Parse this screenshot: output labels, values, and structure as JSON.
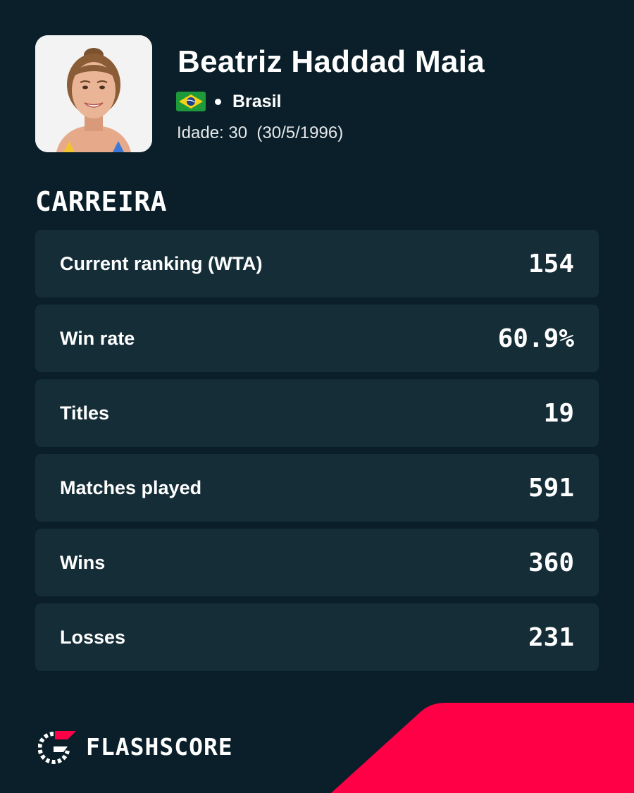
{
  "player": {
    "name": "Beatriz Haddad Maia",
    "country": "Brasil",
    "flag_icon": "brazil-flag-icon",
    "age_line": "Idade: 30  (30/5/1996)"
  },
  "section": {
    "title": "CARREIRA"
  },
  "stats": [
    {
      "label": "Current ranking (WTA)",
      "value": "154"
    },
    {
      "label": "Win rate",
      "value": "60.9%"
    },
    {
      "label": "Titles",
      "value": "19"
    },
    {
      "label": "Matches played",
      "value": "591"
    },
    {
      "label": "Wins",
      "value": "360"
    },
    {
      "label": "Losses",
      "value": "231"
    }
  ],
  "brand": {
    "name": "FLASHSCORE",
    "icon": "flashscore-logo-icon"
  },
  "colors": {
    "background": "#0a1f29",
    "row": "#142d37",
    "accent": "#ff0046"
  }
}
